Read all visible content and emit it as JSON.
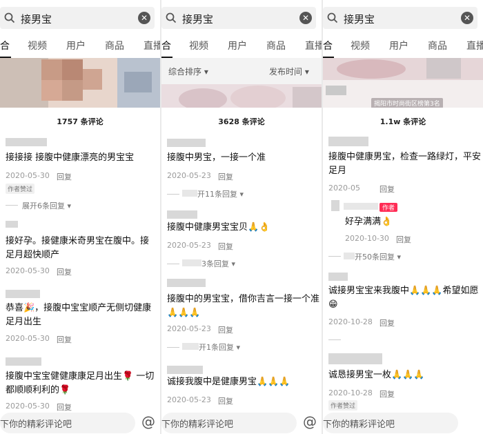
{
  "search_query": "接男宝",
  "clear_label": "✕",
  "tabs": [
    "合",
    "视频",
    "用户",
    "商品",
    "直播"
  ],
  "input_placeholder": "下你的精彩评论吧",
  "at_symbol": "@",
  "panel1": {
    "count": "1757 条评论",
    "comments": [
      {
        "text": "接接接 接腹中健康漂亮的男宝宝",
        "date": "2020-05-30",
        "reply": "回复",
        "badge": "作者赞过",
        "expand": "展开6条回复"
      },
      {
        "text": "接好孕。接健康米奇男宝在腹中。接足月超快顺产",
        "date": "2020-05-30",
        "reply": "回复"
      },
      {
        "text": "恭喜🎉，接腹中宝宝顺产无侧切健康足月出生",
        "date": "2020-05-30",
        "reply": "回复"
      },
      {
        "text": "接腹中宝宝健健康康足月出生🌹 一切都顺顺利利的🌹",
        "date": "2020-05-30",
        "reply": "回复"
      }
    ]
  },
  "panel2": {
    "sort_label": "综合排序",
    "time_label": "发布时间",
    "count": "3628 条评论",
    "comments": [
      {
        "text": "接腹中男宝，一接一个准",
        "date": "2020-05-23",
        "reply": "回复",
        "expand": "开11条回复"
      },
      {
        "text": "接腹中健康男宝宝贝🙏👌",
        "date": "2020-05-23",
        "reply": "回复",
        "expand": "3条回复"
      },
      {
        "text": "接腹中的男宝宝，借你吉言一接一个准🙏🙏🙏",
        "date": "2020-05-23",
        "reply": "回复",
        "expand": "开1条回复"
      },
      {
        "text": "诚接我腹中是健康男宝🙏🙏🙏",
        "date": "2020-05-23",
        "reply": "回复"
      }
    ]
  },
  "panel3": {
    "overlay_tag": "揭阳市时尚街区榜第3名",
    "count": "1.1w 条评论",
    "comments": [
      {
        "text": "接腹中健康男宝，检查一路绿灯，平安足月",
        "date": "2020-05",
        "reply": "回复"
      },
      {
        "author_badge": "作者",
        "text": "好孕满满👌",
        "date": "2020-10-30",
        "reply": "回复",
        "expand": "开50条回复"
      },
      {
        "text": "诚接男宝宝来我腹中🙏🙏🙏希望如愿😁",
        "date": "2020-10-28",
        "reply": "回复"
      },
      {
        "text": "诚恳接男宝一枚🙏🙏🙏",
        "date": "2020-10-28",
        "reply": "回复",
        "badge": "作者赞过"
      }
    ]
  }
}
